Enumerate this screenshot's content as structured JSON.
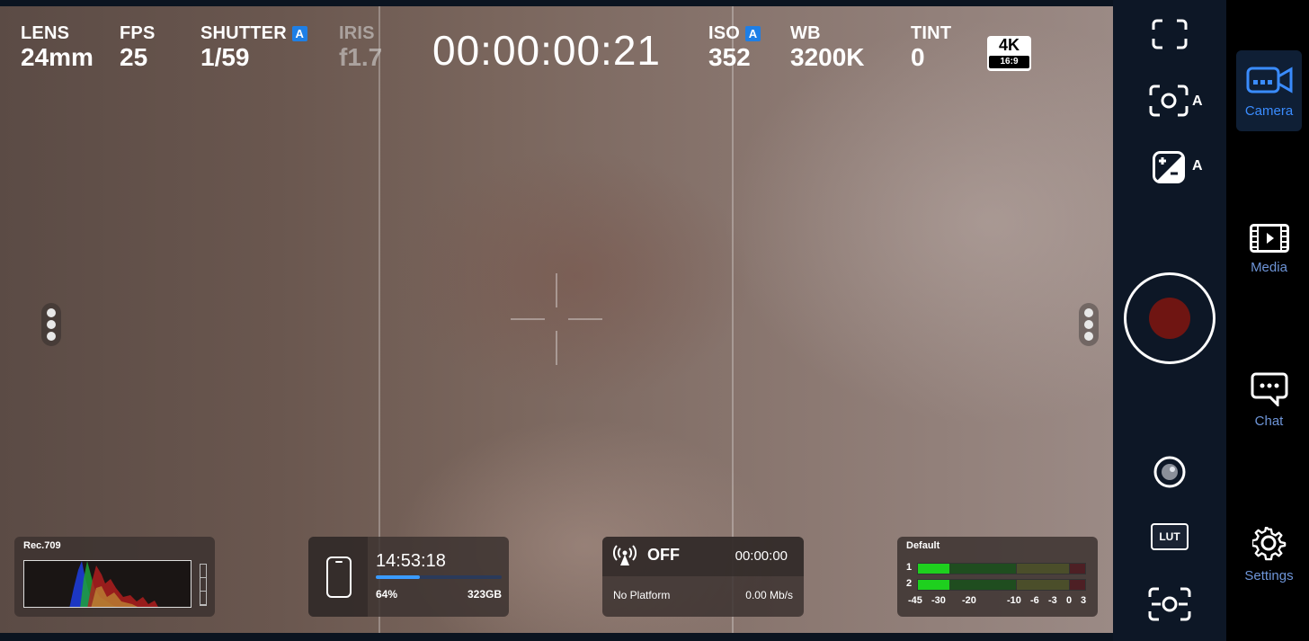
{
  "params": {
    "lens": {
      "label": "LENS",
      "value": "24mm"
    },
    "fps": {
      "label": "FPS",
      "value": "25"
    },
    "shutter": {
      "label": "SHUTTER",
      "value": "1/59",
      "auto": "A"
    },
    "iris": {
      "label": "IRIS",
      "value": "f1.7"
    },
    "iso": {
      "label": "ISO",
      "value": "352",
      "auto": "A"
    },
    "wb": {
      "label": "WB",
      "value": "3200K"
    },
    "tint": {
      "label": "TINT",
      "value": "0"
    }
  },
  "timecode": "00:00:00:21",
  "resolution": {
    "main": "4K",
    "aspect": "16:9"
  },
  "histogram": {
    "title": "Rec.709"
  },
  "storage": {
    "time": "14:53:18",
    "percent": "64%",
    "percent_value": 0.35,
    "free": "323GB"
  },
  "stream": {
    "status": "OFF",
    "time": "00:00:00",
    "platform": "No Platform",
    "rate": "0.00 Mb/s"
  },
  "audio": {
    "title": "Default",
    "channels": [
      {
        "label": "1",
        "level": 0.19
      },
      {
        "label": "2",
        "level": 0.19
      }
    ],
    "scale": [
      "-45",
      "-30",
      "-20",
      "-10",
      "-6",
      "-3",
      "0",
      "3"
    ]
  },
  "controls": {
    "focus_auto": "A",
    "exposure_auto": "A",
    "lut_label": "LUT"
  },
  "nav": {
    "camera": "Camera",
    "media": "Media",
    "chat": "Chat",
    "settings": "Settings"
  },
  "colors": {
    "accent": "#3a8cff",
    "record": "#6f1512",
    "audio_level": "#1ed01e"
  }
}
